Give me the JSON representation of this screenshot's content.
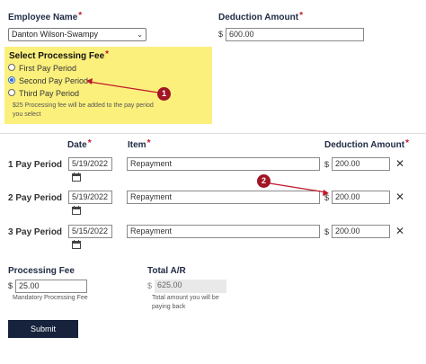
{
  "header": {
    "employee_label": "Employee Name",
    "employee_value": "Danton Wilson-Swampy",
    "deduction_label": "Deduction Amount",
    "currency": "$",
    "deduction_value": "600.00",
    "required_mark": "*"
  },
  "processing_fee_box": {
    "title": "Select Processing Fee",
    "options": [
      {
        "label": "First Pay Period",
        "selected": false
      },
      {
        "label": "Second Pay Period",
        "selected": true
      },
      {
        "label": "Third Pay Period",
        "selected": false
      }
    ],
    "note": "$25 Processing fee will be added to the pay period you select",
    "highlight_color": "#fcf07d"
  },
  "table": {
    "headers": {
      "date": "Date",
      "item": "Item",
      "amount": "Deduction Amount"
    },
    "rows": [
      {
        "label": "1 Pay Period",
        "date": "5/19/2022",
        "item": "Repayment",
        "amount": "200.00"
      },
      {
        "label": "2 Pay Period",
        "date": "5/19/2022",
        "item": "Repayment",
        "amount": "200.00"
      },
      {
        "label": "3 Pay Period",
        "date": "5/15/2022",
        "item": "Repayment",
        "amount": "200.00"
      }
    ],
    "remove_glyph": "✕"
  },
  "footer": {
    "processing_fee_label": "Processing Fee",
    "processing_fee_value": "25.00",
    "processing_fee_note": "Mandatory Processing Fee",
    "total_label": "Total A/R",
    "total_value": "625.00",
    "total_note": "Total amount you will be paying back"
  },
  "submit_label": "Submit",
  "annotations": [
    {
      "number": "1"
    },
    {
      "number": "2"
    }
  ],
  "colors": {
    "required": "#c0172a",
    "annotation": "#a11524",
    "submit_bg": "#17233d",
    "radio_selected": "#2f6fd6"
  }
}
